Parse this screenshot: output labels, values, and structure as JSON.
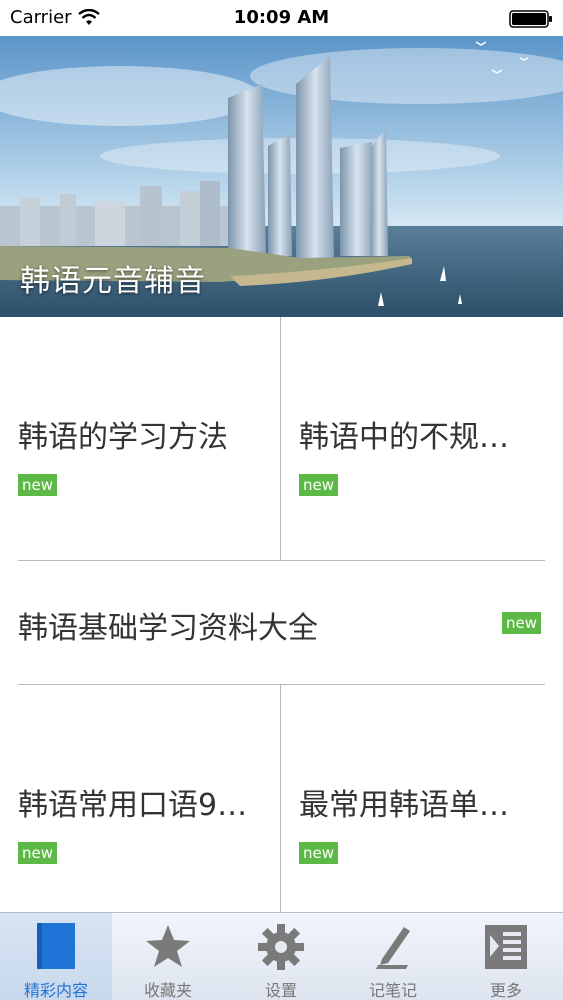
{
  "status_bar": {
    "carrier": "Carrier",
    "time": "10:09 AM"
  },
  "banner": {
    "title": "韩语元音辅音"
  },
  "articles": [
    {
      "title": "韩语的学习方法",
      "badge": "new"
    },
    {
      "title": "韩语中的不规…",
      "badge": "new"
    },
    {
      "title": "韩语基础学习资料大全",
      "badge": "new"
    },
    {
      "title": "韩语常用口语9…",
      "badge": "new"
    },
    {
      "title": "最常用韩语单…",
      "badge": "new"
    }
  ],
  "tabs": [
    {
      "label": "精彩内容",
      "icon": "book-icon",
      "active": true
    },
    {
      "label": "收藏夹",
      "icon": "star-icon",
      "active": false
    },
    {
      "label": "设置",
      "icon": "gear-icon",
      "active": false
    },
    {
      "label": "记笔记",
      "icon": "pen-icon",
      "active": false
    },
    {
      "label": "更多",
      "icon": "more-list-icon",
      "active": false
    }
  ],
  "colors": {
    "badge": "#5db946",
    "active_tab": "#1f74d8",
    "divider": "#b8b8b8"
  }
}
